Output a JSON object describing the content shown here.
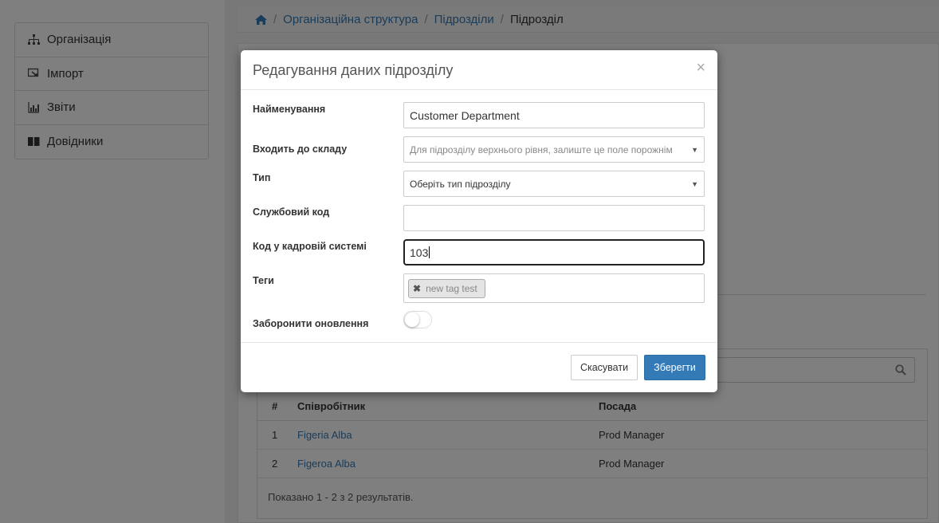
{
  "sidebar": {
    "items": [
      {
        "label": "Організація",
        "icon": "sitemap-icon"
      },
      {
        "label": "Імпорт",
        "icon": "import-icon"
      },
      {
        "label": "Звіти",
        "icon": "bar-chart-icon"
      },
      {
        "label": "Довідники",
        "icon": "book-icon"
      }
    ]
  },
  "breadcrumb": {
    "home_icon": "home-icon",
    "items": [
      "Організаційна структура",
      "Підрозділи"
    ],
    "current": "Підрозділ"
  },
  "employees": {
    "search_icon": "search-icon",
    "columns": [
      "#",
      "Співробітник",
      "Посада"
    ],
    "rows": [
      {
        "num": "1",
        "name": "Figeria Alba",
        "position": "Prod Manager"
      },
      {
        "num": "2",
        "name": "Figeroa Alba",
        "position": "Prod Manager"
      }
    ],
    "summary": "Показано 1 - 2 з 2 результатів."
  },
  "modal": {
    "title": "Редагування даних підрозділу",
    "close_label": "×",
    "fields": {
      "name": {
        "label": "Найменування",
        "value": "Customer Department"
      },
      "parent": {
        "label": "Входить до складу",
        "placeholder": "Для підрозділу верхнього рівня, залиште це поле порожнім"
      },
      "type": {
        "label": "Тип",
        "value": "Оберіть тип підрозділу"
      },
      "service_code": {
        "label": "Службовий код",
        "value": ""
      },
      "hr_code": {
        "label": "Код у кадровій системі",
        "value": "103"
      },
      "tags": {
        "label": "Теги",
        "items": [
          "new tag test"
        ]
      },
      "forbid_updates": {
        "label": "Заборонити оновлення",
        "enabled": false
      }
    },
    "buttons": {
      "cancel": "Скасувати",
      "save": "Зберегти"
    }
  },
  "colors": {
    "accent": "#337ab7",
    "link": "#337ab7"
  }
}
